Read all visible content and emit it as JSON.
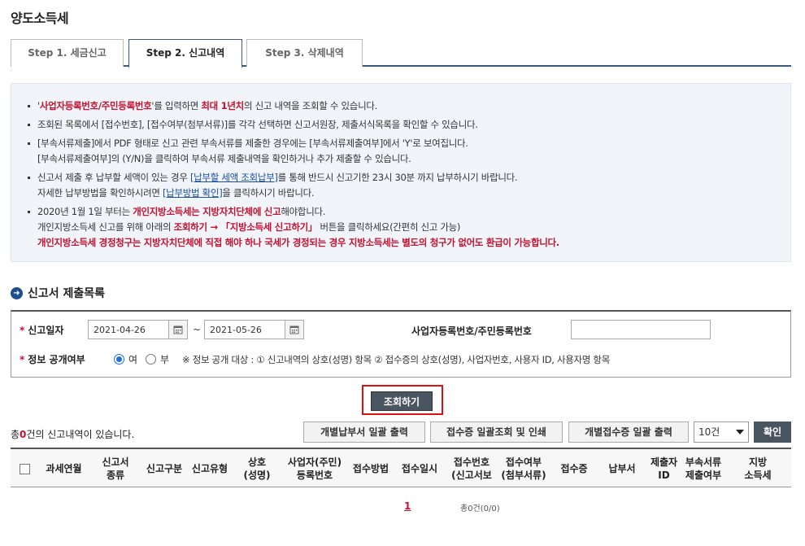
{
  "page": {
    "title": "양도소득세"
  },
  "tabs": [
    {
      "label": "Step 1. 세금신고",
      "active": false
    },
    {
      "label": "Step 2. 신고내역",
      "active": true
    },
    {
      "label": "Step 3. 삭제내역",
      "active": false
    }
  ],
  "notice": {
    "l1_a": "'",
    "l1_b": "사업자등록번호/주민등록번호",
    "l1_c": "'를 입력하면 ",
    "l1_d": "최대 1년치",
    "l1_e": "의 신고 내역을 조회할 수 있습니다.",
    "l2": "조회된 목록에서 [접수번호], [접수여부(첨부서류)]를 각각 선택하면 신고서원장, 제출서식목록을 확인할 수 있습니다.",
    "l3": "[부속서류제출]에서 PDF 형태로 신고 관련 부속서류를 제출한 경우에는 [부속서류제출여부]에서 'Y'로 보여집니다.",
    "l3b": "[부속서류제출여부]의 (Y/N)을 클릭하여 부속서류 제출내역을 확인하거나 추가 제출할 수 있습니다.",
    "l4_a": "신고서 제출 후 납부할 세액이 있는 경우 ",
    "l4_link": "[납부할 세액 조회납부]",
    "l4_b": "를 통해 반드시 신고기한 23시 30분 까지 납부하시기 바랍니다.",
    "l4c_a": "자세한 납부방법을 확인하시려면 ",
    "l4c_link": "[납부방법 확인]",
    "l4c_b": "을 클릭하시기 바랍니다.",
    "l5_a": "2020년 1월 1일 부터는 ",
    "l5_b": "개인지방소득세는 지방자치단체에 신고",
    "l5_c": "해야합니다.",
    "l5d_a": "개인지방소득세 신고를 위해 아래의 ",
    "l5d_b": "조회하기 → 「지방소득세 신고하기」",
    "l5d_c": " 버튼을 클릭하세요(간편히 신고 가능)",
    "l5e": "개인지방소득세 경정청구는 지방자치단체에 직접 해야 하나 국세가 경정되는 경우 지방소득세는 별도의 청구가 없어도 환급이 가능합니다."
  },
  "section": {
    "title": "신고서 제출목록"
  },
  "search": {
    "required_mark": "*",
    "date_label": "신고일자",
    "date_from": "2021-04-26",
    "date_sep": "~",
    "date_to": "2021-05-26",
    "id_label": "사업자등록번호/주민등록번호",
    "id_value": "",
    "public_label": "정보 공개여부",
    "public_yes": "여",
    "public_no": "부",
    "public_selected": "여",
    "public_note": "※ 정보 공개 대상 : ① 신고내역의 상호(성명) 항목 ② 접수증의 상호(성명), 사업자번호, 사용자 ID, 사용자명 항목",
    "query_button": "조회하기"
  },
  "results": {
    "count_prefix": "총",
    "count_value": "0",
    "count_suffix": "건의 신고내역이 있습니다.",
    "btn_bulk_payment": "개별납부서 일괄 출력",
    "btn_receipt_print": "접수증 일괄조회 및 인쇄",
    "btn_bulk_receipt": "개별접수증 일괄 출력",
    "page_size": "10건",
    "btn_confirm": "확인"
  },
  "table": {
    "headers": [
      "과세연월",
      "신고서\n종류",
      "신고구분",
      "신고유형",
      "상호\n(성명)",
      "사업자(주민)\n등록번호",
      "접수방법",
      "접수일시",
      "접수번호\n(신고서보",
      "접수여부\n(첨부서류)",
      "접수증",
      "납부서",
      "제출자\nID",
      "부속서류\n제출여부",
      "지방\n소득세"
    ]
  },
  "pager": {
    "current": "1",
    "total": "총0건(0/0)"
  },
  "colors": {
    "accent": "#1e4e8c",
    "alert": "#c8102e",
    "highlight_border": "#e01010",
    "button_dark": "#4a5562"
  }
}
